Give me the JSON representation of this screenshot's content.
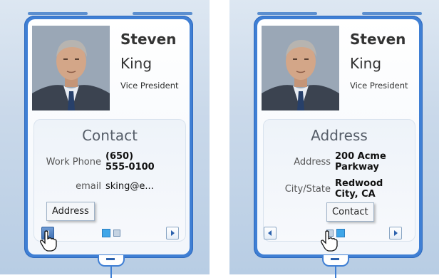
{
  "cards": [
    {
      "first_name": "Steven",
      "last_name": "King",
      "job_title": "Vice President",
      "section_title": "Contact",
      "rows": [
        {
          "label": "Work Phone",
          "value": "(650)\n555-0100"
        },
        {
          "label": "email",
          "value": "sking@e..."
        }
      ],
      "tooltip": "Address",
      "active_page": 1
    },
    {
      "first_name": "Steven",
      "last_name": "King",
      "job_title": "Vice President",
      "section_title": "Address",
      "rows": [
        {
          "label": "Address",
          "value": "200 Acme\nParkway"
        },
        {
          "label": "City/State",
          "value": "Redwood\nCity, CA"
        }
      ],
      "tooltip": "Contact",
      "active_page": 2
    }
  ],
  "colors": {
    "accent": "#3f7fd4",
    "dot_active": "#3fa6e8"
  },
  "icons": [
    "prev-arrow-icon",
    "next-arrow-icon",
    "pointer-hand-icon",
    "collapse-minus-icon"
  ]
}
